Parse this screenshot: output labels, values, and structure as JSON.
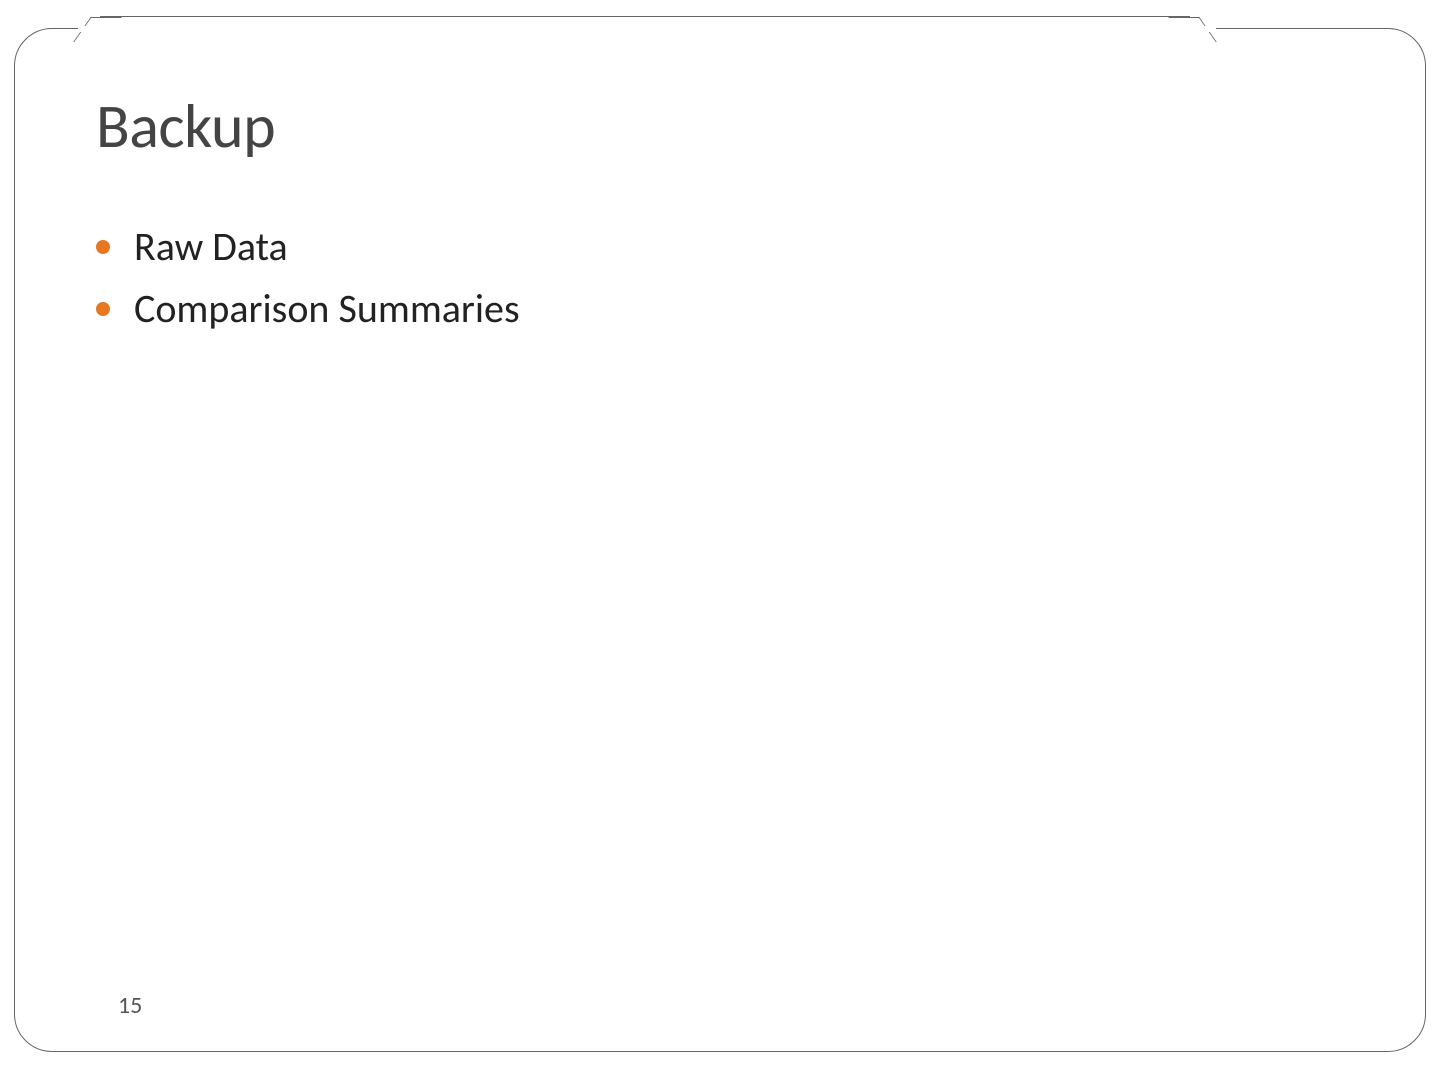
{
  "slide": {
    "title": "Backup",
    "bullets": [
      "Raw Data",
      "Comparison Summaries"
    ],
    "page_number": "15"
  },
  "colors": {
    "accent": "#E87722"
  }
}
